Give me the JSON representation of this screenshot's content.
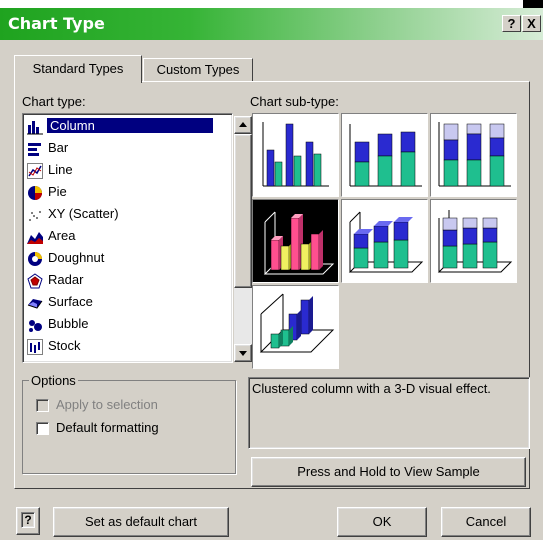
{
  "window": {
    "title": "Chart Type",
    "help_btn": "?",
    "close_btn": "X"
  },
  "tabs": [
    {
      "label": "Standard Types"
    },
    {
      "label": "Custom Types"
    }
  ],
  "chart_type_label": "Chart type:",
  "chart_types": [
    {
      "label": "Column",
      "icon": "column-icon"
    },
    {
      "label": "Bar",
      "icon": "bar-icon"
    },
    {
      "label": "Line",
      "icon": "line-icon"
    },
    {
      "label": "Pie",
      "icon": "pie-icon"
    },
    {
      "label": "XY (Scatter)",
      "icon": "scatter-icon"
    },
    {
      "label": "Area",
      "icon": "area-icon"
    },
    {
      "label": "Doughnut",
      "icon": "doughnut-icon"
    },
    {
      "label": "Radar",
      "icon": "radar-icon"
    },
    {
      "label": "Surface",
      "icon": "surface-icon"
    },
    {
      "label": "Bubble",
      "icon": "bubble-icon"
    },
    {
      "label": "Stock",
      "icon": "stock-icon"
    }
  ],
  "selected_chart_type": "Column",
  "subtype_label": "Chart sub-type:",
  "subtype_count": 7,
  "selected_subtype": 4,
  "options": {
    "legend": "Options",
    "apply_to_selection": "Apply to selection",
    "default_formatting": "Default formatting"
  },
  "description": "Clustered column with a 3-D visual effect.",
  "buttons": {
    "view_sample": "Press and Hold to View Sample",
    "set_default": "Set as default chart",
    "ok": "OK",
    "cancel": "Cancel",
    "help_icon": "?"
  },
  "colors": {
    "navy": "#000080",
    "teal": "#1fbf8f",
    "blue": "#2a2ad0",
    "lavender": "#c8c8f0",
    "pink": "#ff4f8f",
    "yellow": "#f0f060"
  }
}
